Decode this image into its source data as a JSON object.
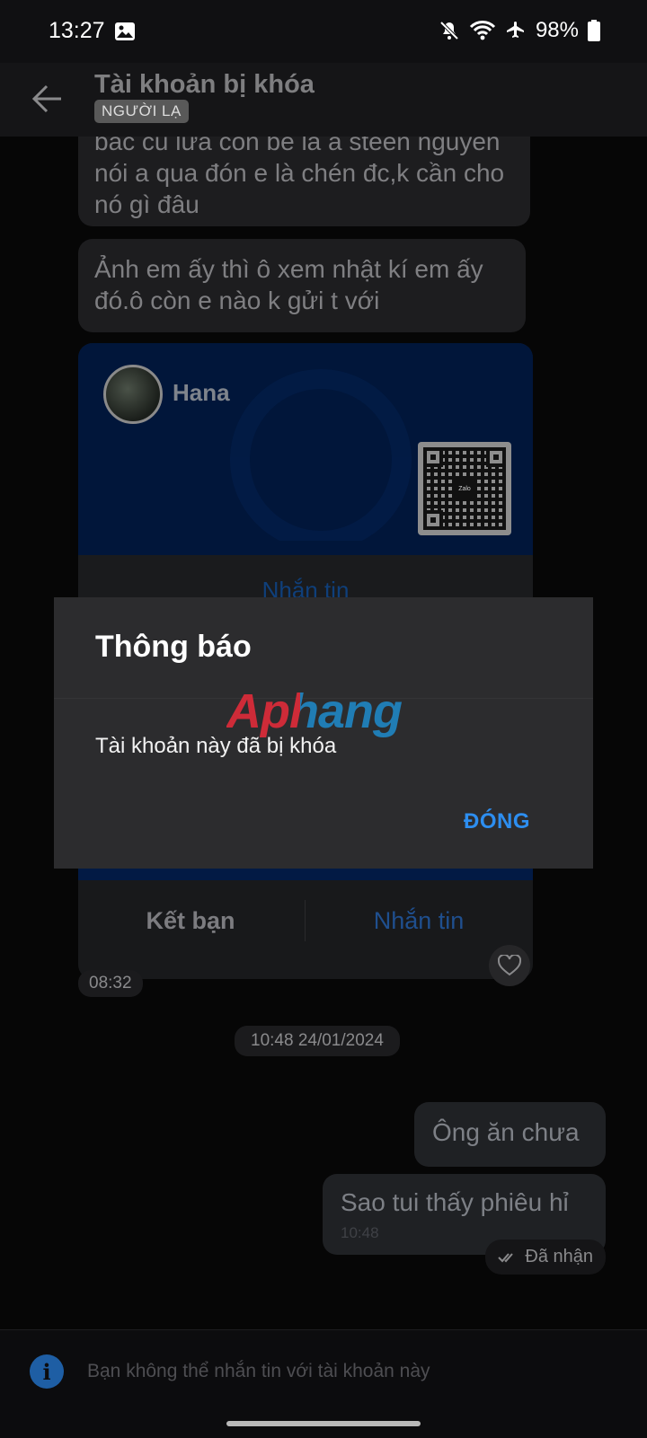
{
  "status_bar": {
    "time": "13:27",
    "battery": "98%"
  },
  "header": {
    "title": "Tài khoản bị khóa",
    "badge": "NGƯỜI LẠ"
  },
  "messages": {
    "incoming_1": "bác cũ lừa con bé là a steen nguyễn nói a qua đón e là chén đc,k cần cho nó gì đâu",
    "incoming_2": "Ảnh em ấy thì ô xem nhật kí em ấy đó.ô còn e nào k gửi t với",
    "card": {
      "name": "Hana",
      "qr_logo": "Zalo",
      "message_label_top": "Nhắn tin",
      "add_friend_label": "Kết bạn",
      "message_label": "Nhắn tin"
    },
    "incoming_time": "08:32",
    "date_separator": "10:48 24/01/2024",
    "outgoing_1": "Ông ăn chưa",
    "outgoing_2": "Sao tui thấy phiêu hỉ",
    "outgoing_2_time": "10:48",
    "status": "Đã nhận"
  },
  "bottom_bar": {
    "text": "Bạn không thể nhắn tin với tài khoản này"
  },
  "dialog": {
    "title": "Thông báo",
    "message": "Tài khoản này đã bị khóa",
    "close_label": "ĐÓNG",
    "watermark": "Aphang"
  },
  "colors": {
    "accent": "#2d8ef0",
    "card_blue": "#01163a",
    "dialog_bg": "#2c2c2e"
  }
}
